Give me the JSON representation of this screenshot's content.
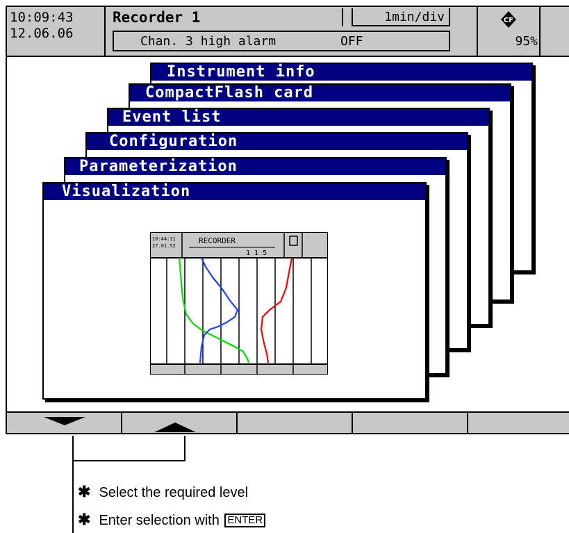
{
  "header": {
    "time": "10:09:43",
    "date": "12.06.06",
    "title": "Recorder 1",
    "timebase": "1min/div",
    "alarm_channel": "Chan. 3 high alarm",
    "alarm_state": "OFF",
    "cf_percent": "95%"
  },
  "menu_levels": [
    "Instrument info",
    "CompactFlash card",
    "Event list",
    "Configuration",
    "Parameterization",
    "Visualization"
  ],
  "thumbnail": {
    "title": "RECORDER",
    "timebase": "1 1 5",
    "time": "10:44:11",
    "date": "27.01.52"
  },
  "softkeys": [
    "down-arrow-icon",
    "up-arrow-icon",
    "",
    "",
    ""
  ],
  "instructions": {
    "line1": "Select the required level",
    "line2_prefix": "Enter selection with",
    "line2_key": "ENTER",
    "bullet": "✱"
  },
  "colors": {
    "title_bar": "#000080",
    "panel_gray": "#c8c8c8",
    "trace_green": "#00e000",
    "trace_blue": "#2040ff",
    "trace_red": "#ff0000"
  }
}
